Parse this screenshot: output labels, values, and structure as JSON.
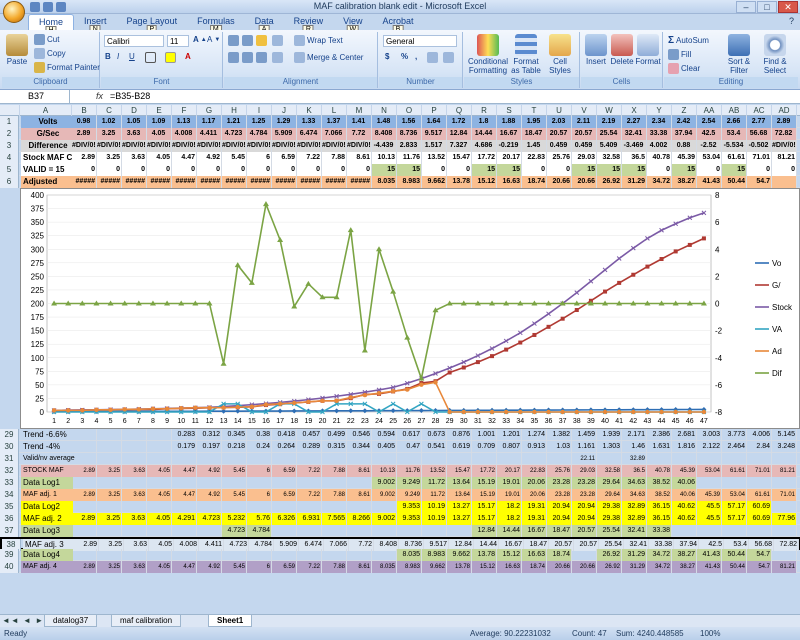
{
  "window": {
    "title": "MAF calibration blank edit - Microsoft Excel"
  },
  "ribbon": {
    "tabs": [
      {
        "label": "Home",
        "key": "H"
      },
      {
        "label": "Insert",
        "key": "N"
      },
      {
        "label": "Page Layout",
        "key": "P"
      },
      {
        "label": "Formulas",
        "key": "M"
      },
      {
        "label": "Data",
        "key": "A"
      },
      {
        "label": "Review",
        "key": "R"
      },
      {
        "label": "View",
        "key": "W"
      },
      {
        "label": "Acrobat",
        "key": "B"
      }
    ],
    "clipboard": {
      "paste": "Paste",
      "cut": "Cut",
      "copy": "Copy",
      "format_painter": "Format Painter",
      "label": "Clipboard"
    },
    "font": {
      "name": "Calibri",
      "size": "11",
      "label": "Font"
    },
    "alignment": {
      "wrap": "Wrap Text",
      "merge": "Merge & Center",
      "label": "Alignment"
    },
    "number": {
      "format": "General",
      "label": "Number",
      "currency": "$",
      "percent": "%",
      "comma": ","
    },
    "styles": {
      "conditional": "Conditional Formatting",
      "table": "Format as Table",
      "cell": "Cell Styles",
      "label": "Styles"
    },
    "cells": {
      "insert": "Insert",
      "delete": "Delete",
      "format": "Format",
      "label": "Cells"
    },
    "editing": {
      "autosum": "AutoSum",
      "fill": "Fill",
      "clear": "Clear",
      "sort": "Sort & Filter",
      "find": "Find & Select",
      "label": "Editing"
    }
  },
  "formula_bar": {
    "name_box": "B37",
    "fx": "fx",
    "formula": "=B35-B28"
  },
  "columns": [
    "A",
    "B",
    "C",
    "D",
    "E",
    "F",
    "G",
    "H",
    "I",
    "J",
    "K",
    "L",
    "M",
    "N",
    "O",
    "P",
    "Q",
    "R",
    "S",
    "T",
    "U",
    "V",
    "W",
    "X",
    "Y",
    "Z",
    "AA",
    "AB",
    "AC",
    "AD"
  ],
  "top_rows": [
    {
      "rn": "1",
      "label": "Volts",
      "values": [
        "0.98",
        "1.02",
        "1.05",
        "1.09",
        "1.13",
        "1.17",
        "1.21",
        "1.25",
        "1.29",
        "1.33",
        "1.37",
        "1.41",
        "1.48",
        "1.56",
        "1.64",
        "1.72",
        "1.8",
        "1.88",
        "1.95",
        "2.03",
        "2.11",
        "2.19",
        "2.27",
        "2.34",
        "2.42",
        "2.54",
        "2.66",
        "2.77",
        "2.89"
      ]
    },
    {
      "rn": "2",
      "label": "G/Sec",
      "values": [
        "2.89",
        "3.25",
        "3.63",
        "4.05",
        "4.008",
        "4.411",
        "4.723",
        "4.784",
        "5.909",
        "6.474",
        "7.066",
        "7.72",
        "8.408",
        "8.736",
        "9.517",
        "12.84",
        "14.44",
        "16.67",
        "18.47",
        "20.57",
        "20.57",
        "25.54",
        "32.41",
        "33.38",
        "37.94",
        "42.5",
        "53.4",
        "56.68",
        "72.82"
      ]
    },
    {
      "rn": "3",
      "label": "Difference",
      "values": [
        "#DIV/0!",
        "#DIV/0!",
        "#DIV/0!",
        "#DIV/0!",
        "#DIV/0!",
        "#DIV/0!",
        "#DIV/0!",
        "#DIV/0!",
        "#DIV/0!",
        "#DIV/0!",
        "#DIV/0!",
        "#DIV/0!",
        "-4.439",
        "2.833",
        "1.517",
        "7.327",
        "4.686",
        "-0.219",
        "1.45",
        "0.459",
        "0.459",
        "5.409",
        "-3.469",
        "4.002",
        "0.88",
        "-2.52",
        "-5.534",
        "-0.502",
        "#DIV/0!"
      ]
    },
    {
      "rn": "4",
      "label": "Stock MAF CAL",
      "values": [
        "2.89",
        "3.25",
        "3.63",
        "4.05",
        "4.47",
        "4.92",
        "5.45",
        "6",
        "6.59",
        "7.22",
        "7.88",
        "8.61",
        "10.13",
        "11.76",
        "13.52",
        "15.47",
        "17.72",
        "20.17",
        "22.83",
        "25.76",
        "29.03",
        "32.58",
        "36.5",
        "40.78",
        "45.39",
        "53.04",
        "61.61",
        "71.01",
        "81.21"
      ]
    },
    {
      "rn": "5",
      "label": "VALID = 15",
      "values": [
        "0",
        "0",
        "0",
        "0",
        "0",
        "0",
        "0",
        "0",
        "0",
        "0",
        "0",
        "0",
        "15",
        "15",
        "0",
        "0",
        "15",
        "15",
        "0",
        "0",
        "15",
        "15",
        "15",
        "0",
        "15",
        "0",
        "15",
        "0",
        "0"
      ]
    },
    {
      "rn": "6",
      "label": "Adjusted",
      "values": [
        "#####",
        "#####",
        "#####",
        "#####",
        "#####",
        "#####",
        "#####",
        "#####",
        "#####",
        "#####",
        "#####",
        "#####",
        "8.035",
        "8.983",
        "9.662",
        "13.78",
        "15.12",
        "16.63",
        "18.74",
        "20.66",
        "20.66",
        "26.92",
        "31.29",
        "34.72",
        "38.27",
        "41.43",
        "50.44",
        "54.7",
        ""
      ]
    }
  ],
  "bottom_rows": [
    {
      "rn": "29",
      "label": "Trend -6.6%",
      "values": [
        "",
        "",
        "",
        "",
        "0.283",
        "0.312",
        "0.345",
        "0.38",
        "0.418",
        "0.457",
        "0.499",
        "0.546",
        "0.594",
        "0.617",
        "0.673",
        "0.876",
        "1.001",
        "1.201",
        "1.274",
        "1.382",
        "1.459",
        "1.939",
        "2.171",
        "2.386",
        "2.681",
        "3.003",
        "3.773",
        "4.006",
        "5.145"
      ]
    },
    {
      "rn": "30",
      "label": "Trend -4%",
      "values": [
        "",
        "",
        "",
        "",
        "0.179",
        "0.197",
        "0.218",
        "0.24",
        "0.264",
        "0.289",
        "0.315",
        "0.344",
        "0.405",
        "0.47",
        "0.541",
        "0.619",
        "0.709",
        "0.807",
        "0.913",
        "1.03",
        "1.161",
        "1.303",
        "1.46",
        "1.631",
        "1.816",
        "2.122",
        "2.464",
        "2.84",
        "3.248"
      ]
    },
    {
      "rn": "31",
      "label": "Valid/nv average",
      "values": [
        "",
        "",
        "",
        "",
        "",
        "",
        "",
        "",
        "",
        "",
        "",
        "",
        "",
        "",
        "",
        "",
        "",
        "",
        "",
        "",
        "22.11",
        "",
        "32.89",
        "",
        "",
        "",
        "",
        "",
        ""
      ]
    },
    {
      "rn": "32",
      "label": "STOCK MAF",
      "values": [
        "2.89",
        "3.25",
        "3.63",
        "4.05",
        "4.47",
        "4.92",
        "5.45",
        "6",
        "6.59",
        "7.22",
        "7.88",
        "8.61",
        "10.13",
        "11.76",
        "13.52",
        "15.47",
        "17.72",
        "20.17",
        "22.83",
        "25.76",
        "29.03",
        "32.58",
        "36.5",
        "40.78",
        "45.39",
        "53.04",
        "61.61",
        "71.01",
        "81.21"
      ]
    },
    {
      "rn": "33",
      "label": "Data Log1",
      "values": [
        "",
        "",
        "",
        "",
        "",
        "",
        "",
        "",
        "",
        "",
        "",
        "",
        "9.002",
        "9.249",
        "11.72",
        "13.64",
        "15.19",
        "19.01",
        "20.06",
        "23.28",
        "23.28",
        "29.64",
        "34.63",
        "38.52",
        "40.06",
        "",
        "",
        "",
        ""
      ]
    },
    {
      "rn": "34",
      "label": "MAF adj. 1",
      "values": [
        "2.89",
        "3.25",
        "3.63",
        "4.05",
        "4.47",
        "4.92",
        "5.45",
        "6",
        "6.59",
        "7.22",
        "7.88",
        "8.61",
        "9.002",
        "9.249",
        "11.72",
        "13.64",
        "15.19",
        "19.01",
        "20.06",
        "23.28",
        "23.28",
        "29.64",
        "34.63",
        "38.52",
        "40.06",
        "45.39",
        "53.04",
        "61.61",
        "71.01"
      ]
    },
    {
      "rn": "35",
      "label": "Data Log2",
      "values": [
        "",
        "",
        "",
        "",
        "",
        "",
        "",
        "",
        "",
        "",
        "",
        "",
        "",
        "9.353",
        "10.19",
        "13.27",
        "15.17",
        "18.2",
        "19.31",
        "20.94",
        "20.94",
        "29.38",
        "32.89",
        "36.15",
        "40.62",
        "45.5",
        "57.17",
        "60.69",
        ""
      ]
    },
    {
      "rn": "36",
      "label": "MAF adj. 2",
      "values": [
        "2.89",
        "3.25",
        "3.63",
        "4.05",
        "4.291",
        "4.723",
        "5.232",
        "5.76",
        "6.326",
        "6.931",
        "7.565",
        "8.266",
        "9.002",
        "9.353",
        "10.19",
        "13.27",
        "15.17",
        "18.2",
        "19.31",
        "20.94",
        "20.94",
        "29.38",
        "32.89",
        "36.15",
        "40.62",
        "45.5",
        "57.17",
        "60.69",
        "77.96"
      ]
    },
    {
      "rn": "37",
      "label": "Data Log3",
      "values": [
        "",
        "",
        "",
        "",
        "",
        "",
        "4.723",
        "4.784",
        "",
        "",
        "",
        "",
        "",
        "",
        "",
        "",
        "12.84",
        "14.44",
        "16.67",
        "18.47",
        "20.57",
        "25.54",
        "32.41",
        "33.38",
        "",
        "",
        "",
        "",
        ""
      ]
    },
    {
      "rn": "38",
      "label": "MAF adj. 3",
      "values": [
        "2.89",
        "3.25",
        "3.63",
        "4.05",
        "4.008",
        "4.411",
        "4.723",
        "4.784",
        "5.909",
        "6.474",
        "7.066",
        "7.72",
        "8.408",
        "8.736",
        "9.517",
        "12.84",
        "14.44",
        "16.67",
        "18.47",
        "20.57",
        "20.57",
        "25.54",
        "32.41",
        "33.38",
        "37.94",
        "42.5",
        "53.4",
        "56.68",
        "72.82"
      ]
    },
    {
      "rn": "39",
      "label": "Data Log4",
      "values": [
        "",
        "",
        "",
        "",
        "",
        "",
        "",
        "",
        "",
        "",
        "",
        "",
        "",
        "8.035",
        "8.983",
        "9.662",
        "13.78",
        "15.12",
        "16.63",
        "18.74",
        "",
        "26.92",
        "31.29",
        "34.72",
        "38.27",
        "41.43",
        "50.44",
        "54.7",
        ""
      ]
    },
    {
      "rn": "40",
      "label": "MAF adj. 4",
      "values": [
        "2.89",
        "3.25",
        "3.63",
        "4.05",
        "4.47",
        "4.92",
        "5.45",
        "6",
        "6.59",
        "7.22",
        "7.88",
        "8.61",
        "8.035",
        "8.983",
        "9.662",
        "13.78",
        "15.12",
        "16.63",
        "18.74",
        "20.66",
        "20.66",
        "26.92",
        "31.29",
        "34.72",
        "38.27",
        "41.43",
        "50.44",
        "54.7",
        "81.21"
      ]
    }
  ],
  "chart_data": {
    "type": "line",
    "x": [
      1,
      2,
      3,
      4,
      5,
      6,
      7,
      8,
      9,
      10,
      11,
      12,
      13,
      14,
      15,
      16,
      17,
      18,
      19,
      20,
      21,
      22,
      23,
      24,
      25,
      26,
      27,
      28,
      29,
      30,
      31,
      32,
      33,
      34,
      35,
      36,
      37,
      38,
      39,
      40,
      41,
      42,
      43,
      44,
      45,
      46,
      47
    ],
    "ylim": [
      0,
      400
    ],
    "y2lim": [
      -8,
      8
    ],
    "left_ticks": [
      0,
      25,
      50,
      75,
      100,
      125,
      150,
      175,
      200,
      225,
      250,
      275,
      300,
      325,
      350,
      375,
      400
    ],
    "right_ticks": [
      -8,
      -6,
      -4,
      -2,
      0,
      2,
      4,
      6,
      8
    ],
    "legend_position": "right",
    "series": [
      {
        "name": "Vo",
        "color": "#2e6eb5",
        "axis": "left",
        "values": [
          0.98,
          1.02,
          1.05,
          1.09,
          1.13,
          1.17,
          1.21,
          1.25,
          1.29,
          1.33,
          1.37,
          1.41,
          1.48,
          1.56,
          1.64,
          1.72,
          1.8,
          1.88,
          1.95,
          2.03,
          2.11,
          2.19,
          2.27,
          2.34,
          2.42,
          2.54,
          2.66,
          2.77,
          2.89,
          3.0,
          3.1,
          3.2,
          3.3,
          3.4,
          3.5,
          3.6,
          3.7,
          3.8,
          3.9,
          4.0,
          4.1,
          4.2,
          4.3,
          4.4,
          4.5,
          4.6,
          4.7
        ]
      },
      {
        "name": "G/",
        "color": "#b03a33",
        "axis": "left",
        "values": [
          2.89,
          3.25,
          3.63,
          4.05,
          4.0,
          4.4,
          4.7,
          4.8,
          5.9,
          6.5,
          7.1,
          7.7,
          8.4,
          8.7,
          9.5,
          12.8,
          14.4,
          16.7,
          18.5,
          20.6,
          20.6,
          25.5,
          32.4,
          33.4,
          37.9,
          42.5,
          53.4,
          56.7,
          72.8,
          82,
          92,
          103,
          115,
          128,
          142,
          157,
          172,
          188,
          205,
          222,
          238,
          253,
          268,
          282,
          296,
          308,
          320
        ]
      },
      {
        "name": "Stock",
        "color": "#7b5aa6",
        "axis": "left",
        "values": [
          2.89,
          3.25,
          3.63,
          4.05,
          4.47,
          4.92,
          5.45,
          6,
          6.59,
          7.22,
          7.88,
          8.61,
          10.13,
          11.76,
          13.52,
          15.47,
          17.72,
          20.17,
          22.83,
          25.76,
          29.03,
          32.58,
          36.5,
          40.78,
          45.39,
          53.04,
          61.61,
          71.01,
          81.21,
          92,
          104,
          117,
          131,
          146,
          163,
          181,
          200,
          220,
          241,
          262,
          283,
          302,
          320,
          335,
          347,
          358,
          367
        ]
      },
      {
        "name": "VA",
        "color": "#33a5c2",
        "axis": "left",
        "values": [
          0,
          0,
          0,
          0,
          0,
          0,
          0,
          0,
          0,
          0,
          0,
          0,
          15,
          15,
          0,
          0,
          15,
          15,
          0,
          0,
          15,
          15,
          15,
          0,
          15,
          0,
          15,
          0,
          0,
          0,
          0,
          0,
          0,
          0,
          0,
          0,
          0,
          0,
          0,
          0,
          0,
          0,
          0,
          0,
          0,
          0,
          0
        ]
      },
      {
        "name": "Ad",
        "color": "#e8883a",
        "axis": "left",
        "values": [
          3,
          3,
          3,
          4,
          4,
          5,
          5,
          6,
          6,
          7,
          8,
          8,
          8.0,
          9.0,
          9.7,
          13.8,
          15.1,
          16.6,
          18.7,
          20.7,
          20.7,
          26.9,
          31.3,
          34.7,
          38.3,
          41.4,
          50.4,
          54.7,
          0,
          0,
          0,
          0,
          0,
          0,
          0,
          0,
          0,
          0,
          0,
          0,
          0,
          0,
          0,
          0,
          0,
          0,
          0
        ]
      },
      {
        "name": "Dif",
        "color": "#7ba444",
        "axis": "right",
        "values": [
          0,
          0,
          0,
          0,
          0,
          0,
          0,
          0,
          0,
          0,
          0,
          0,
          -4.439,
          2.833,
          1.517,
          7.327,
          4.686,
          -0.219,
          1.45,
          0.459,
          0.459,
          5.409,
          -3.469,
          4.002,
          0.88,
          -2.52,
          -5.534,
          -0.502,
          0,
          0,
          0,
          0,
          0,
          0,
          0,
          0,
          0,
          0,
          0,
          0,
          0,
          0,
          0,
          0,
          0,
          0,
          0
        ]
      }
    ]
  },
  "sheets": [
    {
      "label": "datalog37",
      "active": false
    },
    {
      "label": "maf calibration",
      "active": false
    },
    {
      "label": "Sheet1",
      "active": true
    }
  ],
  "status": {
    "ready": "Ready",
    "average": "Average: 90.22231032",
    "count": "Count: 47",
    "sum": "Sum: 4240.448585",
    "zoom": "100%"
  },
  "colors": {
    "ribbon_bg": "#d7e5f6",
    "header_bg": "#e4ecf7",
    "row1_fill": "#8db3e2",
    "row2_fill": "#e6b8b7",
    "row3_fill": "#d9d9d9",
    "row5_fill": "#c4d79b",
    "row6_fill": "#fabf8f",
    "yellow": "#ffff00",
    "green": "#c4d79b",
    "purple": "#b1a0c7"
  }
}
